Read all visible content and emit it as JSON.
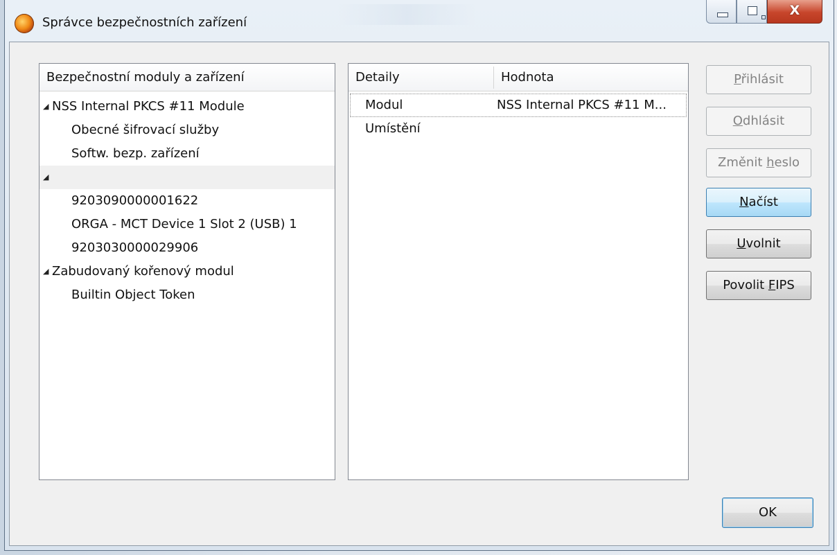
{
  "window": {
    "title": "Správce bezpečnostních zařízení"
  },
  "left_tree": {
    "header": "Bezpečnostní moduly a zařízení",
    "rows": [
      {
        "label": "NSS Internal PKCS #11 Module",
        "level": 0,
        "expanded": true
      },
      {
        "label": "Obecné šifrovací služby",
        "level": 1
      },
      {
        "label": "Softw. bezp. zařízení",
        "level": 1
      },
      {
        "label": "",
        "level": 0,
        "expanded": true,
        "highlighted": true
      },
      {
        "label": "9203090000001622",
        "level": 1
      },
      {
        "label": "ORGA - MCT Device 1 Slot 2 (USB) 1",
        "level": 1
      },
      {
        "label": "9203030000029906",
        "level": 1
      },
      {
        "label": "Zabudovaný kořenový modul",
        "level": 0,
        "expanded": true
      },
      {
        "label": "Builtin Object Token",
        "level": 1
      }
    ]
  },
  "details_table": {
    "columns": [
      "Detaily",
      "Hodnota"
    ],
    "rows": [
      {
        "detail": "Modul",
        "value": "NSS Internal PKCS #11 M..."
      },
      {
        "detail": "Umístění",
        "value": ""
      }
    ]
  },
  "buttons": {
    "login": {
      "pre": "",
      "acc": "P",
      "post": "řihlásit",
      "enabled": false
    },
    "logout": {
      "pre": "",
      "acc": "O",
      "post": "dhlásit",
      "enabled": false
    },
    "change_password": {
      "pre": "Změnit ",
      "acc": "h",
      "post": "eslo",
      "enabled": false
    },
    "load": {
      "pre": "",
      "acc": "N",
      "post": "ačíst",
      "enabled": true
    },
    "unload": {
      "pre": "",
      "acc": "U",
      "post": "volnit",
      "enabled": true
    },
    "enable_fips": {
      "pre": "Povolit ",
      "acc": "F",
      "post": "IPS",
      "enabled": true
    },
    "ok": "OK"
  },
  "icons": {
    "app": "firefox-icon",
    "expanded_twisty": "◢"
  }
}
